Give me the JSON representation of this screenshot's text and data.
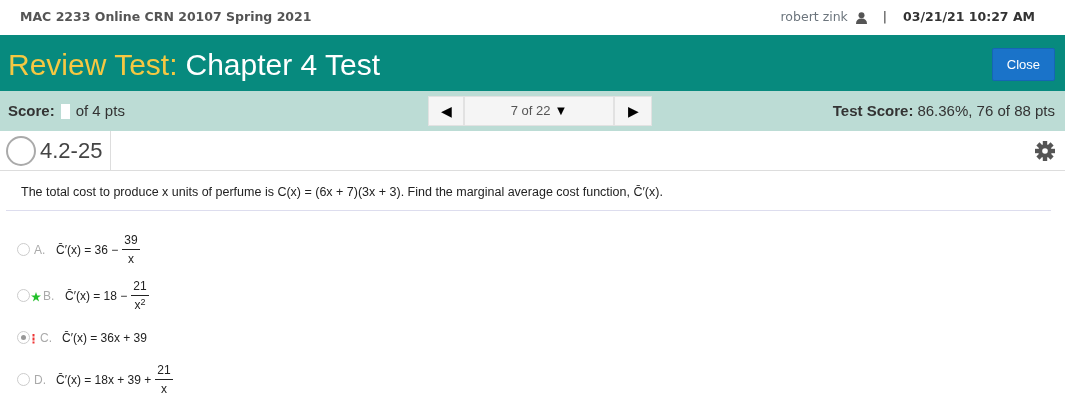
{
  "top_bar": {
    "course": "MAC 2233 Online CRN 20107 Spring 2021",
    "user": "robert zink",
    "separator": "|",
    "datetime": "03/21/21 10:27 AM"
  },
  "header": {
    "prefix": "Review Test:",
    "title": "Chapter 4 Test",
    "close_button": "Close"
  },
  "score_bar": {
    "score_label": "Score:",
    "score_suffix": "of 4 pts",
    "prev": "◀",
    "position": "7 of 22",
    "dropdown": "▼",
    "next": "▶",
    "test_score_label": "Test Score:",
    "test_score": "86.36%, 76 of 88 pts"
  },
  "question": {
    "number": "4.2-25",
    "answered": false,
    "text": "The total cost to produce x units of perfume is C(x) = (6x + 7)(3x + 3). Find the marginal average cost function, C̄′(x)."
  },
  "options": [
    {
      "letter": "A.",
      "selected": false,
      "kind": "plain",
      "expression": "C̄′(x) = 36 −",
      "fraction": {
        "numerator": "39",
        "denominator": "x"
      }
    },
    {
      "letter": "B.",
      "selected": false,
      "kind": "correct",
      "expression": "C̄′(x) = 18 −",
      "fraction": {
        "numerator": "21",
        "denominator": "x$^{2}$"
      }
    },
    {
      "letter": "C.",
      "selected": true,
      "kind": "incorrect",
      "expression": "C̄′(x) = 36x + 39"
    },
    {
      "letter": "D.",
      "selected": false,
      "kind": "plain",
      "expression": "C̄′(x) = 18x + 39 +",
      "fraction": {
        "numerator": "21",
        "denominator": "x"
      }
    }
  ]
}
